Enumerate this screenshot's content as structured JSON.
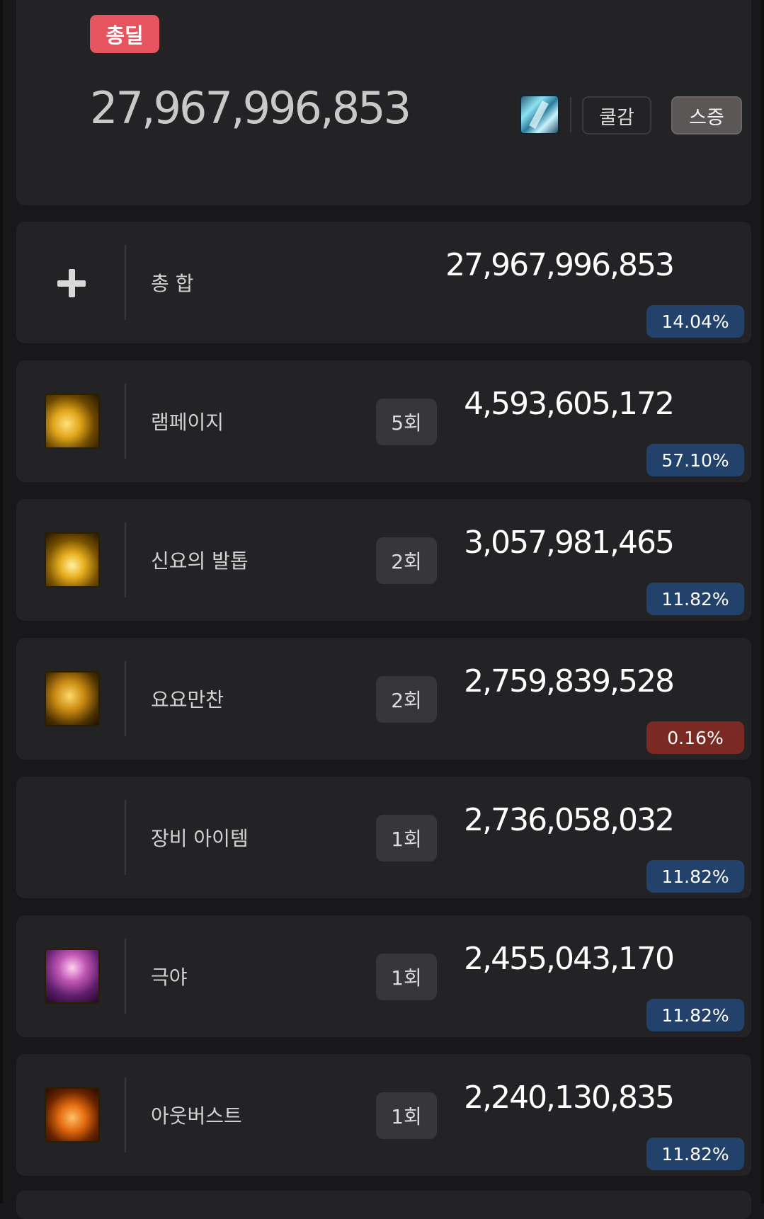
{
  "summary": {
    "badge": "총딜",
    "total": "27,967,996,853",
    "skill_icon": "ice-crystal-skill-icon",
    "buttons": {
      "cooldown": "쿨감",
      "amplify": "스증"
    }
  },
  "rows": [
    {
      "icon": "plus-icon",
      "name": "총 합",
      "count": "",
      "value": "27,967,996,853",
      "pct": "14.04%",
      "pct_color": "#22426b"
    },
    {
      "icon": "rampage-skill-icon",
      "name": "램페이지",
      "count": "5회",
      "value": "4,593,605,172",
      "pct": "57.10%",
      "pct_color": "#22426b"
    },
    {
      "icon": "divine-step-skill-icon",
      "name": "신요의 발톱",
      "count": "2회",
      "value": "3,057,981,465",
      "pct": "11.82%",
      "pct_color": "#22426b"
    },
    {
      "icon": "yoyo-manchan-skill-icon",
      "name": "요요만찬",
      "count": "2회",
      "value": "2,759,839,528",
      "pct": "0.16%",
      "pct_color": "#7a2a22"
    },
    {
      "icon": "",
      "name": "장비 아이템",
      "count": "1회",
      "value": "2,736,058,032",
      "pct": "11.82%",
      "pct_color": "#22426b"
    },
    {
      "icon": "extreme-night-skill-icon",
      "name": "극야",
      "count": "1회",
      "value": "2,455,043,170",
      "pct": "11.82%",
      "pct_color": "#22426b"
    },
    {
      "icon": "outburst-skill-icon",
      "name": "아웃버스트",
      "count": "1회",
      "value": "2,240,130,835",
      "pct": "11.82%",
      "pct_color": "#22426b"
    }
  ]
}
